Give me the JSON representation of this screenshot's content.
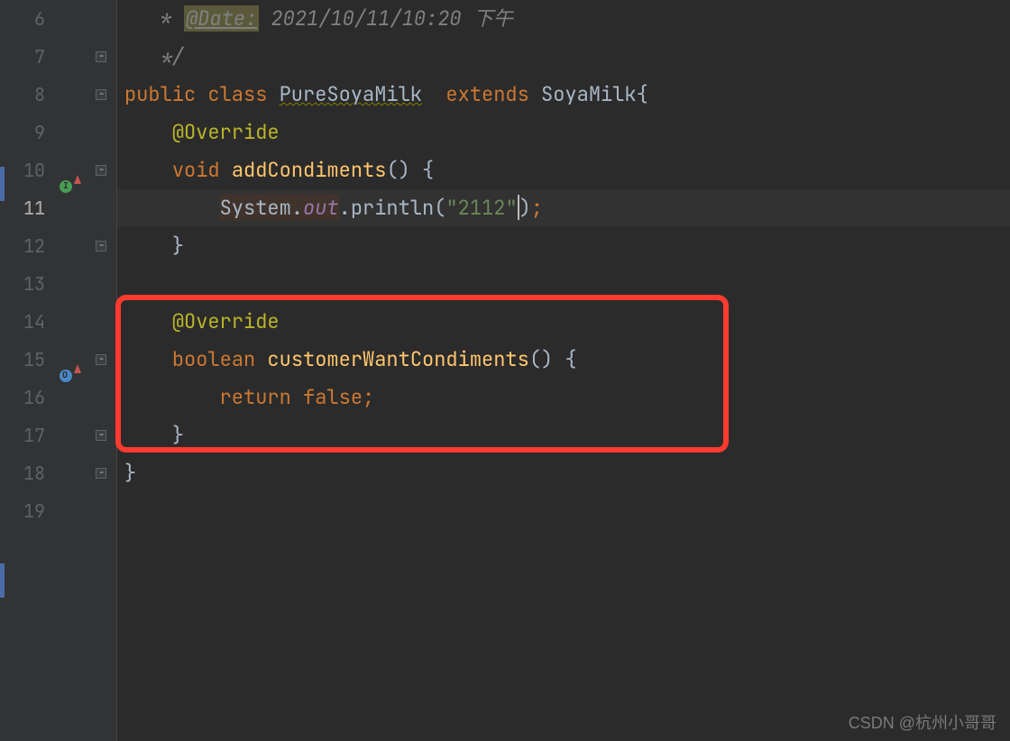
{
  "lineNumbers": [
    "6",
    "7",
    "8",
    "9",
    "10",
    "11",
    "12",
    "13",
    "14",
    "15",
    "16",
    "17",
    "18",
    "19"
  ],
  "currentLine": "11",
  "code": {
    "line6": {
      "prefix": " * ",
      "docTag": "@Date:",
      "afterTag": " 2021/10/11/10:20 下午"
    },
    "line7": " */",
    "line8": {
      "kw1": "public ",
      "kw2": "class ",
      "className": "PureSoyaMilk",
      "spaces": "  ",
      "kw3": "extends ",
      "parentClass": "SoyaMilk",
      "brace": "{"
    },
    "line9": "@Override",
    "line10": {
      "kw": "void ",
      "method": "addCondiments",
      "params": "()",
      "brace": " {"
    },
    "line11": {
      "system": "System",
      "dot1": ".",
      "out": "out",
      "dot2": ".",
      "println": "println",
      "open": "(",
      "string": "\"2112\"",
      "close": ")",
      "semi": ";"
    },
    "line12": "}",
    "line14": "@Override",
    "line15": {
      "kw": "boolean ",
      "method": "customerWantCondiments",
      "params": "()",
      "brace": " {"
    },
    "line16": {
      "kw": "return ",
      "val": "false",
      "semi": ";"
    },
    "line17": "}",
    "line18": "}"
  },
  "watermark": "CSDN @杭州小哥哥"
}
